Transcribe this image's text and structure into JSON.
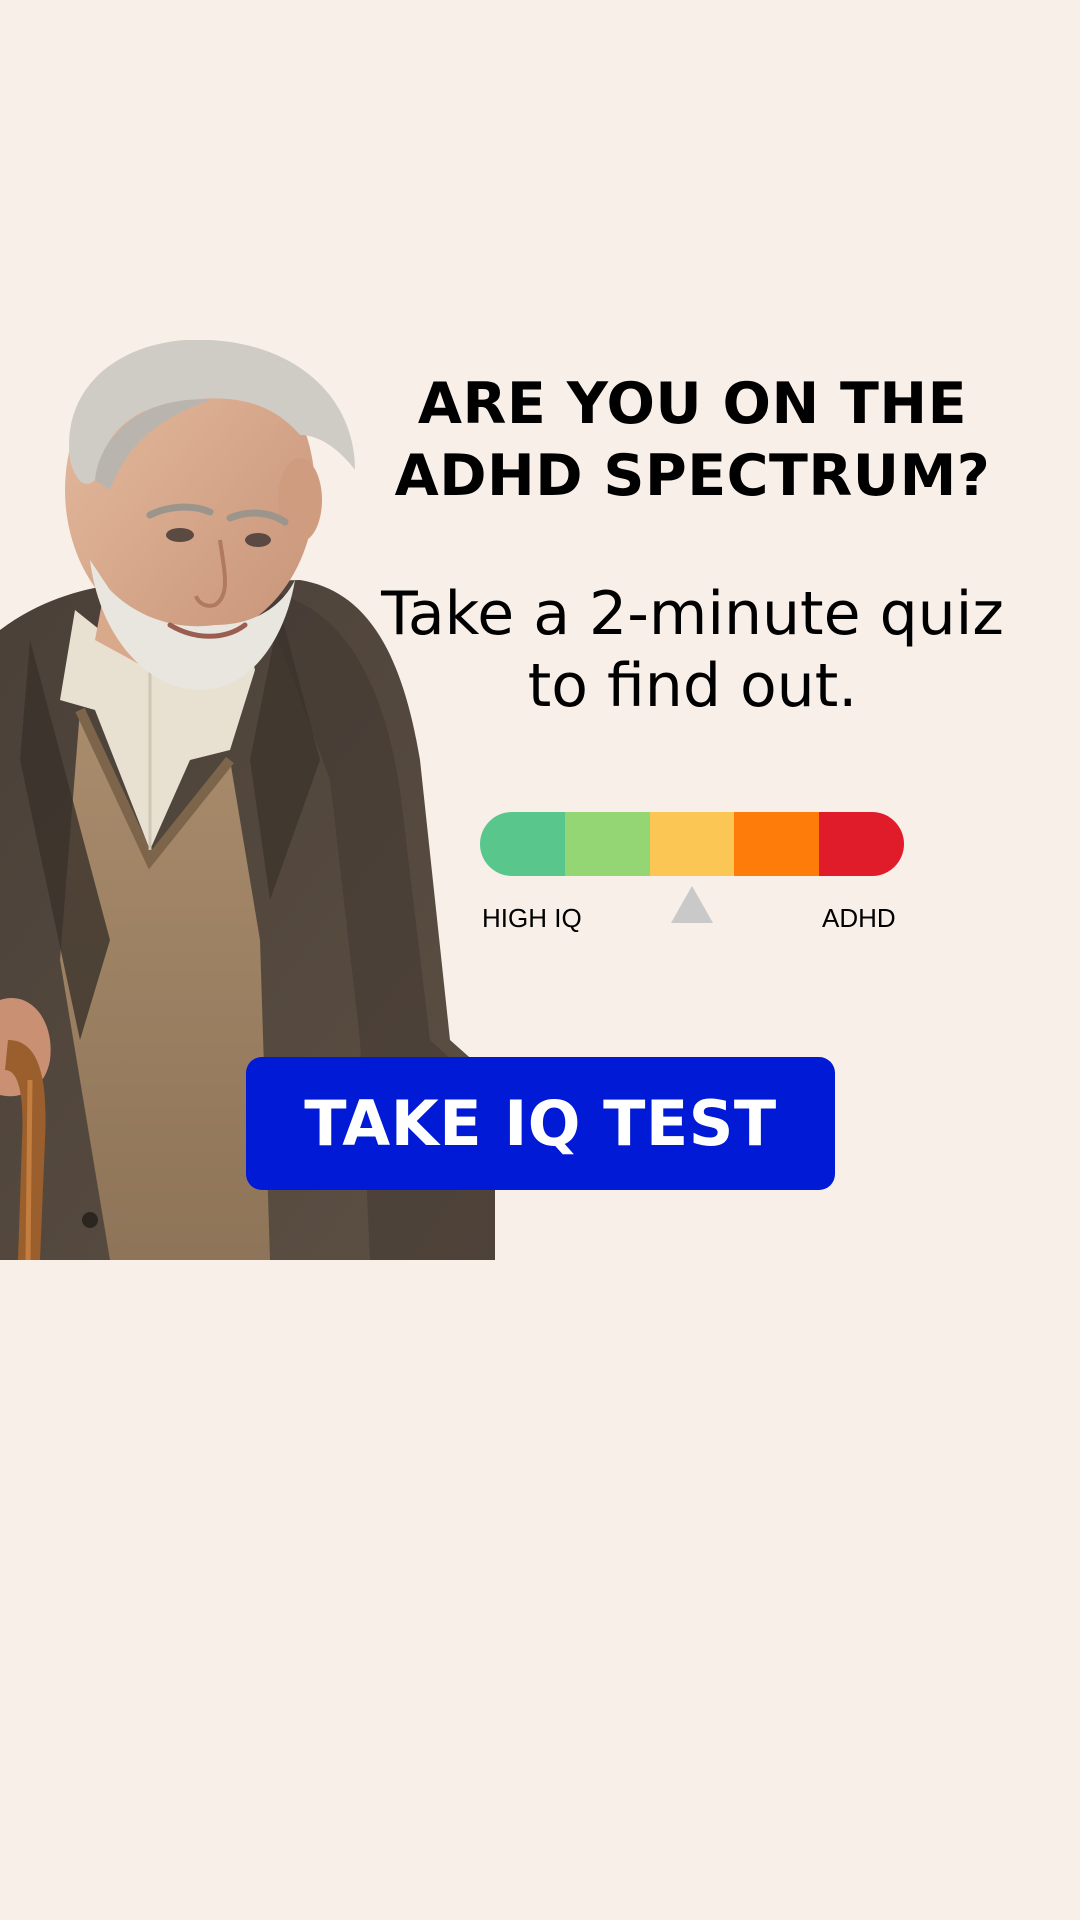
{
  "headline": {
    "line1": "ARE YOU ON THE",
    "line2": "ADHD SPECTRUM?"
  },
  "subhead": {
    "line1": "Take a 2-minute quiz",
    "line2": "to find out."
  },
  "meter": {
    "segments": [
      {
        "color": "#59c68b"
      },
      {
        "color": "#93d673"
      },
      {
        "color": "#fcc655"
      },
      {
        "color": "#fe7d0a"
      },
      {
        "color": "#e01b2a"
      }
    ],
    "pointer_level": 0.5,
    "left_label": "HIGH IQ",
    "right_label": "ADHD"
  },
  "cta": {
    "label": "TAKE IQ TEST",
    "color": "#001ad6"
  },
  "colors": {
    "background": "#f8efe8"
  }
}
